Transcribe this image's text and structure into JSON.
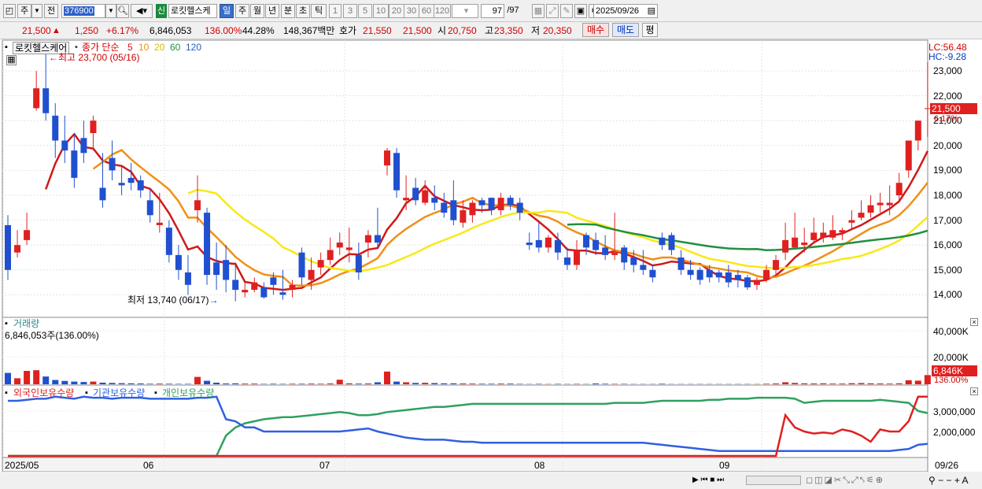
{
  "toolbar": {
    "market": "주",
    "market_arrow": "▼",
    "period": "전",
    "code": "376900",
    "code_arrow": "▼",
    "new_badge": "신",
    "stock_name": "로킷헬스케",
    "periods": [
      "일",
      "주",
      "월",
      "년",
      "분",
      "초",
      "틱"
    ],
    "intervals": [
      "1",
      "3",
      "5",
      "10",
      "20",
      "30",
      "60",
      "120"
    ],
    "count": "97",
    "total": "/97",
    "date": "2025/09/26"
  },
  "quote": {
    "price": "21,500",
    "arrow": "▲",
    "change": "1,250",
    "rate": "+6.17%",
    "volume": "6,846,053",
    "vol_ratio": "136.00%",
    "turnover": "44.28%",
    "amount": "148,367백만",
    "hoga_label": "호가",
    "ask": "21,550",
    "bid": "21,500",
    "open_label": "시",
    "open": "20,750",
    "high_label": "고",
    "high": "23,350",
    "low_label": "저",
    "low": "20,350",
    "buy": "매수",
    "sell": "매도",
    "eval": "평"
  },
  "price_pane": {
    "stock_tag": "로킷헬스케어",
    "ma_title": "종가 단순",
    "ma": [
      "5",
      "10",
      "20",
      "60",
      "120"
    ],
    "ma_colors": [
      "#d01818",
      "#f09018",
      "#f8e818",
      "#209040",
      "#2060c0"
    ],
    "max_label": "최고 23,700 (05/16)",
    "min_label": "최저 13,740 (06/17)",
    "lc": "LC:56.48",
    "hc": "HC:-9.28",
    "ticks": [
      "23,000",
      "22,000",
      "21,000",
      "20,000",
      "19,000",
      "18,000",
      "17,000",
      "16,000",
      "15,000",
      "14,000"
    ],
    "cur_price": "21,500",
    "cur_rate": "6.17%"
  },
  "volume_pane": {
    "title": "거래량",
    "value": "6,846,053주(136.00%)",
    "ticks": [
      "40,000K",
      "20,000K"
    ],
    "cur": "6,846K",
    "cur_rate": "136.00%"
  },
  "holder_pane": {
    "series": [
      "외국인보유수량",
      "기관보유수량",
      "개인보유수량"
    ],
    "ticks": [
      "3,000,000",
      "2,000,000"
    ]
  },
  "xaxis": {
    "labels": [
      "2025/05",
      "06",
      "07",
      "08",
      "09"
    ],
    "end": "09/26"
  },
  "colors": {
    "up": "#e02020",
    "down": "#2050d0",
    "foreign": "#e02020",
    "inst": "#3060e0",
    "indiv": "#30a060"
  },
  "chart_data": {
    "type": "candlestick",
    "x": [
      "05-08",
      "05-09",
      "05-12",
      "05-13",
      "05-14",
      "05-15",
      "05-16",
      "05-19",
      "05-20",
      "05-21",
      "05-22",
      "05-23",
      "05-26",
      "05-27",
      "05-28",
      "05-29",
      "05-30",
      "06-02",
      "06-04",
      "06-05",
      "06-09",
      "06-10",
      "06-11",
      "06-12",
      "06-13",
      "06-16",
      "06-17",
      "06-18",
      "06-19",
      "06-20",
      "06-23",
      "06-24",
      "06-25",
      "06-26",
      "06-27",
      "06-30",
      "07-01",
      "07-02",
      "07-03",
      "07-04",
      "07-07",
      "07-08",
      "07-09",
      "07-10",
      "07-11",
      "07-14",
      "07-15",
      "07-16",
      "07-17",
      "07-18",
      "07-21",
      "07-22",
      "07-23",
      "07-24",
      "07-25",
      "07-28",
      "07-29",
      "07-30",
      "07-31",
      "08-01",
      "08-04",
      "08-05",
      "08-06",
      "08-07",
      "08-08",
      "08-11",
      "08-12",
      "08-13",
      "08-14",
      "08-18",
      "08-19",
      "08-20",
      "08-21",
      "08-22",
      "08-25",
      "08-26",
      "08-27",
      "08-28",
      "08-29",
      "09-01",
      "09-02",
      "09-03",
      "09-04",
      "09-05",
      "09-08",
      "09-09",
      "09-10",
      "09-11",
      "09-12",
      "09-15",
      "09-16",
      "09-17",
      "09-18",
      "09-19",
      "09-22",
      "09-23",
      "09-24",
      "09-25",
      "09-26"
    ],
    "open": [
      16800,
      15700,
      16200,
      21500,
      22300,
      21200,
      20200,
      19800,
      20300,
      20500,
      18300,
      19500,
      18500,
      18700,
      18600,
      17800,
      16800,
      16700,
      15600,
      14900,
      17400,
      17300,
      15300,
      15400,
      14600,
      14100,
      14200,
      14300,
      14700,
      14100,
      14200,
      15700,
      14600,
      15100,
      15400,
      15900,
      15800,
      15600,
      16100,
      16400,
      19200,
      19700,
      17800,
      18300,
      17700,
      17900,
      17700,
      17800,
      16900,
      17200,
      17800,
      17900,
      17400,
      17900,
      17700,
      16100,
      16200,
      15900,
      16200,
      15500,
      15200,
      16400,
      16200,
      15900,
      15600,
      15900,
      15500,
      15200,
      15000,
      16300,
      16400,
      15500,
      15000,
      15000,
      15000,
      14900,
      14900,
      14800,
      14700,
      14400,
      14600,
      15000,
      15700,
      15900,
      16000,
      16200,
      16300,
      16300,
      16500,
      16900,
      17100,
      17300,
      17600,
      17600,
      18000,
      19000,
      20200,
      21500
    ],
    "close": [
      15000,
      16000,
      16600,
      22300,
      21300,
      20200,
      19800,
      18700,
      19700,
      21000,
      17800,
      19000,
      18400,
      18500,
      18200,
      17200,
      16900,
      15600,
      15000,
      14400,
      17800,
      14800,
      14800,
      14600,
      14200,
      14200,
      14500,
      13900,
      14400,
      14000,
      14400,
      14700,
      15000,
      15400,
      15800,
      16100,
      15900,
      14900,
      16400,
      16100,
      19800,
      18200,
      17900,
      17800,
      18200,
      17700,
      17300,
      17000,
      17400,
      17700,
      17600,
      17400,
      17900,
      17600,
      17300,
      16000,
      15900,
      16300,
      15700,
      15200,
      15800,
      15900,
      15800,
      15600,
      15700,
      15300,
      15200,
      15000,
      14700,
      16000,
      15800,
      15000,
      14800,
      14600,
      14700,
      14700,
      14500,
      14600,
      14300,
      14600,
      15000,
      15400,
      16200,
      16300,
      16100,
      16500,
      16500,
      16600,
      16600,
      17000,
      17300,
      17600,
      17700,
      17700,
      18500,
      20200,
      21000,
      21500
    ],
    "high": [
      17200,
      16600,
      17300,
      23000,
      23700,
      21700,
      21200,
      20500,
      21000,
      21200,
      19700,
      20200,
      19200,
      19300,
      18800,
      18300,
      18100,
      17000,
      16000,
      15600,
      18800,
      17500,
      16100,
      16000,
      15300,
      14500,
      14700,
      14500,
      14900,
      15000,
      14600,
      15900,
      15500,
      15700,
      16300,
      16500,
      16700,
      16100,
      16600,
      17500,
      19900,
      19900,
      18800,
      18700,
      18600,
      18400,
      18100,
      18600,
      17800,
      17800,
      17900,
      17900,
      18100,
      18000,
      17900,
      16500,
      16900,
      16400,
      16500,
      15900,
      16200,
      16500,
      16500,
      16400,
      17300,
      16000,
      15800,
      15800,
      15200,
      16500,
      16500,
      15800,
      15400,
      15100,
      15200,
      15000,
      15200,
      15000,
      14800,
      14700,
      15200,
      15600,
      16900,
      17300,
      16700,
      17100,
      16900,
      17200,
      16700,
      17400,
      17800,
      18000,
      18100,
      18400,
      18900,
      20100,
      21000,
      23350
    ],
    "low": [
      14600,
      15500,
      16000,
      21400,
      21000,
      19500,
      19300,
      18300,
      19300,
      19800,
      17500,
      18600,
      18000,
      18200,
      17900,
      16900,
      16500,
      15300,
      14600,
      14000,
      16900,
      14400,
      14200,
      14100,
      13740,
      13900,
      14100,
      13850,
      14000,
      13800,
      13900,
      14400,
      14200,
      14800,
      15200,
      15600,
      15300,
      14600,
      15500,
      15900,
      18800,
      17900,
      17400,
      17600,
      17600,
      17400,
      17100,
      16800,
      16700,
      16900,
      17300,
      17200,
      17200,
      17400,
      17000,
      15800,
      15700,
      15700,
      15400,
      15000,
      15000,
      15600,
      15600,
      15400,
      15400,
      15000,
      14900,
      14800,
      14500,
      15800,
      15600,
      14800,
      14600,
      14400,
      14500,
      14500,
      14300,
      14300,
      14200,
      14200,
      14500,
      14800,
      15400,
      15900,
      15700,
      16100,
      16100,
      16200,
      16200,
      16600,
      17000,
      17100,
      17300,
      17200,
      17700,
      18700,
      19800,
      20350
    ],
    "volume": [
      8500,
      4500,
      10000,
      10500,
      5800,
      3200,
      2500,
      2000,
      1700,
      2000,
      1200,
      1000,
      800,
      700,
      600,
      400,
      500,
      400,
      300,
      300,
      5500,
      2600,
      1200,
      600,
      700,
      500,
      500,
      300,
      400,
      300,
      400,
      400,
      500,
      400,
      600,
      3400,
      700,
      500,
      600,
      1500,
      9500,
      2000,
      1500,
      1000,
      1100,
      900,
      700,
      700,
      600,
      500,
      400,
      400,
      500,
      500,
      300,
      200,
      300,
      200,
      300,
      200,
      300,
      200,
      600,
      400,
      300,
      300,
      200,
      200,
      200,
      400,
      200,
      200,
      200,
      200,
      200,
      200,
      200,
      200,
      200,
      200,
      400,
      600,
      1500,
      1000,
      700,
      600,
      700,
      500,
      500,
      800,
      900,
      700,
      600,
      500,
      700,
      3000,
      2700,
      6846
    ],
    "foreign_holding": [
      120000,
      90000,
      80000,
      60000,
      60000,
      150000,
      60000,
      50000,
      180000,
      100000,
      100000,
      50000,
      100000,
      140000,
      100000,
      100000,
      100000,
      100000,
      100000,
      100000,
      150000,
      90000,
      60000,
      60000,
      50000,
      50000,
      50000,
      50000,
      50000,
      50000,
      50000,
      50000,
      50000,
      50000,
      50000,
      50000,
      50000,
      50000,
      90000,
      50000,
      50000,
      50000,
      50000,
      50000,
      50000,
      50000,
      50000,
      50000,
      50000,
      50000,
      50000,
      50000,
      50000,
      50000,
      50000,
      50000,
      50000,
      50000,
      50000,
      50000,
      50000,
      50000,
      50000,
      50000,
      50000,
      50000,
      50000,
      50000,
      50000,
      50000,
      50000,
      50000,
      50000,
      50000,
      50000,
      50000,
      50000,
      50000,
      50000,
      50000,
      50000,
      50000,
      2800000,
      2200000,
      2000000,
      1900000,
      1950000,
      1900000,
      2100000,
      2000000,
      1800000,
      1500000,
      2100000,
      2000000,
      2000000,
      2500000,
      3700000,
      3700000
    ],
    "institution_holding": [
      3500000,
      3500000,
      3550000,
      3600000,
      3600000,
      3700000,
      3650000,
      3600000,
      3700000,
      3650000,
      3650000,
      3600000,
      3650000,
      3650000,
      3650000,
      3600000,
      3600000,
      3600000,
      3600000,
      3600000,
      3650000,
      3650000,
      3700000,
      2600000,
      2500000,
      2200000,
      2200000,
      2000000,
      2000000,
      2000000,
      2000000,
      2000000,
      2000000,
      2000000,
      2000000,
      2000000,
      2050000,
      2100000,
      2150000,
      2000000,
      1900000,
      1800000,
      1700000,
      1650000,
      1600000,
      1600000,
      1600000,
      1550000,
      1500000,
      1500000,
      1450000,
      1450000,
      1450000,
      1450000,
      1450000,
      1450000,
      1450000,
      1450000,
      1450000,
      1450000,
      1450000,
      1450000,
      1450000,
      1450000,
      1450000,
      1450000,
      1450000,
      1450000,
      1400000,
      1350000,
      1300000,
      1250000,
      1200000,
      1150000,
      1100000,
      1050000,
      1050000,
      1050000,
      1050000,
      1050000,
      1050000,
      1050000,
      1050000,
      1050000,
      1050000,
      1050000,
      1050000,
      1050000,
      1050000,
      1050000,
      1050000,
      1050000,
      1050000,
      1050000,
      1100000,
      1150000,
      1350000,
      1400000
    ],
    "individual_holding": [
      150000,
      130000,
      130000,
      120000,
      110000,
      120000,
      110000,
      110000,
      120000,
      110000,
      110000,
      110000,
      110000,
      120000,
      110000,
      110000,
      110000,
      120000,
      130000,
      110000,
      200000,
      150000,
      100000,
      1800000,
      2200000,
      2400000,
      2500000,
      2600000,
      2650000,
      2700000,
      2700000,
      2750000,
      2800000,
      2850000,
      2900000,
      2950000,
      2900000,
      2800000,
      2800000,
      2850000,
      2950000,
      3000000,
      3050000,
      3100000,
      3150000,
      3200000,
      3200000,
      3250000,
      3300000,
      3350000,
      3350000,
      3350000,
      3350000,
      3350000,
      3350000,
      3350000,
      3350000,
      3350000,
      3350000,
      3350000,
      3350000,
      3350000,
      3350000,
      3350000,
      3400000,
      3400000,
      3400000,
      3400000,
      3450000,
      3500000,
      3500000,
      3500000,
      3500000,
      3500000,
      3550000,
      3550000,
      3600000,
      3600000,
      3600000,
      3650000,
      3650000,
      3650000,
      3650000,
      3600000,
      3400000,
      3450000,
      3500000,
      3500000,
      3500000,
      3500000,
      3500000,
      3500000,
      3550000,
      3500000,
      3450000,
      3400000,
      3000000,
      2900000
    ]
  }
}
